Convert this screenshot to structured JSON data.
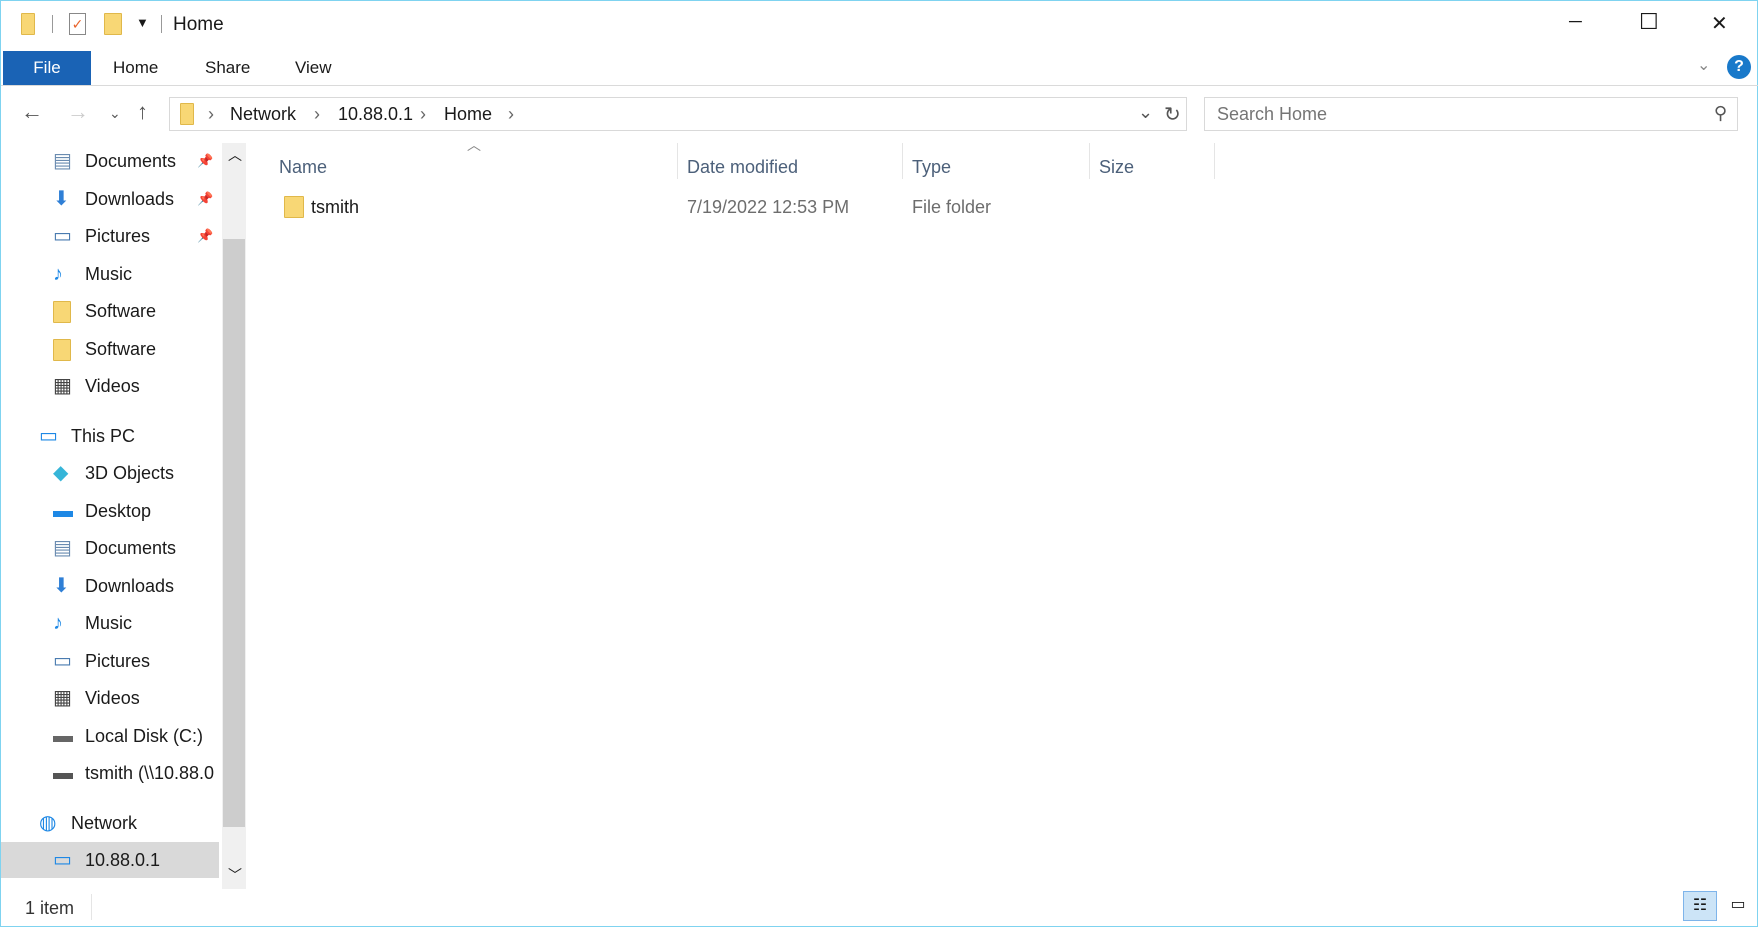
{
  "window": {
    "title": "Home",
    "minimize": "─",
    "maximize": "☐",
    "close": "✕"
  },
  "ribbon": {
    "tabs": [
      "File",
      "Home",
      "Share",
      "View"
    ],
    "help": "?"
  },
  "address": {
    "crumbs": [
      "Network",
      "10.88.0.1",
      "Home"
    ],
    "search_placeholder": "Search Home"
  },
  "sidebar": {
    "quick": [
      {
        "label": "Documents",
        "icon": "documents-icon",
        "pinned": true
      },
      {
        "label": "Downloads",
        "icon": "downloads-icon",
        "pinned": true
      },
      {
        "label": "Pictures",
        "icon": "pictures-icon",
        "pinned": true
      },
      {
        "label": "Music",
        "icon": "music-icon"
      },
      {
        "label": "Software",
        "icon": "folder-icon"
      },
      {
        "label": "Software",
        "icon": "folder-icon"
      },
      {
        "label": "Videos",
        "icon": "videos-icon"
      }
    ],
    "this_pc": "This PC",
    "pc_items": [
      {
        "label": "3D Objects",
        "icon": "3d-objects-icon"
      },
      {
        "label": "Desktop",
        "icon": "desktop-icon"
      },
      {
        "label": "Documents",
        "icon": "documents-icon"
      },
      {
        "label": "Downloads",
        "icon": "downloads-icon"
      },
      {
        "label": "Music",
        "icon": "music-icon"
      },
      {
        "label": "Pictures",
        "icon": "pictures-icon"
      },
      {
        "label": "Videos",
        "icon": "videos-icon"
      },
      {
        "label": "Local Disk (C:)",
        "icon": "local-disk-icon"
      },
      {
        "label": "tsmith (\\\\10.88.0",
        "icon": "network-drive-icon"
      }
    ],
    "network": "Network",
    "network_items": [
      {
        "label": "10.88.0.1",
        "icon": "computer-icon",
        "selected": true
      }
    ]
  },
  "columns": [
    "Name",
    "Date modified",
    "Type",
    "Size"
  ],
  "files": [
    {
      "name": "tsmith",
      "date": "7/19/2022 12:53 PM",
      "type": "File folder",
      "size": ""
    }
  ],
  "status": {
    "count": "1 item"
  },
  "colors": {
    "accent": "#1979ca",
    "file_tab": "#1a63b5",
    "selected": "#d9d9d9"
  }
}
